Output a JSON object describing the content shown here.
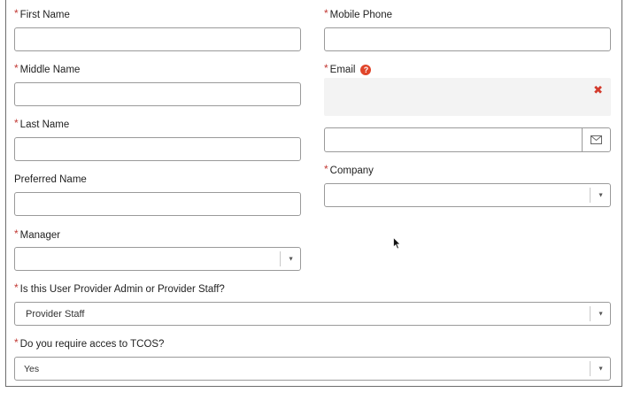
{
  "form": {
    "first_name": {
      "label": "First Name",
      "value": ""
    },
    "mobile_phone": {
      "label": "Mobile Phone",
      "value": ""
    },
    "middle_name": {
      "label": "Middle Name",
      "value": ""
    },
    "email": {
      "label": "Email",
      "help": "?",
      "clear": "✖",
      "value": ""
    },
    "last_name": {
      "label": "Last Name",
      "value": ""
    },
    "preferred_name": {
      "label": "Preferred Name",
      "value": ""
    },
    "company": {
      "label": "Company",
      "value": ""
    },
    "manager": {
      "label": "Manager",
      "value": ""
    },
    "user_type": {
      "label": "Is this User Provider Admin or Provider Staff?",
      "value": "Provider Staff"
    },
    "tcos_access": {
      "label": "Do you require acces to TCOS?",
      "value": "Yes"
    },
    "required_marker": "*",
    "caret": "▼"
  }
}
